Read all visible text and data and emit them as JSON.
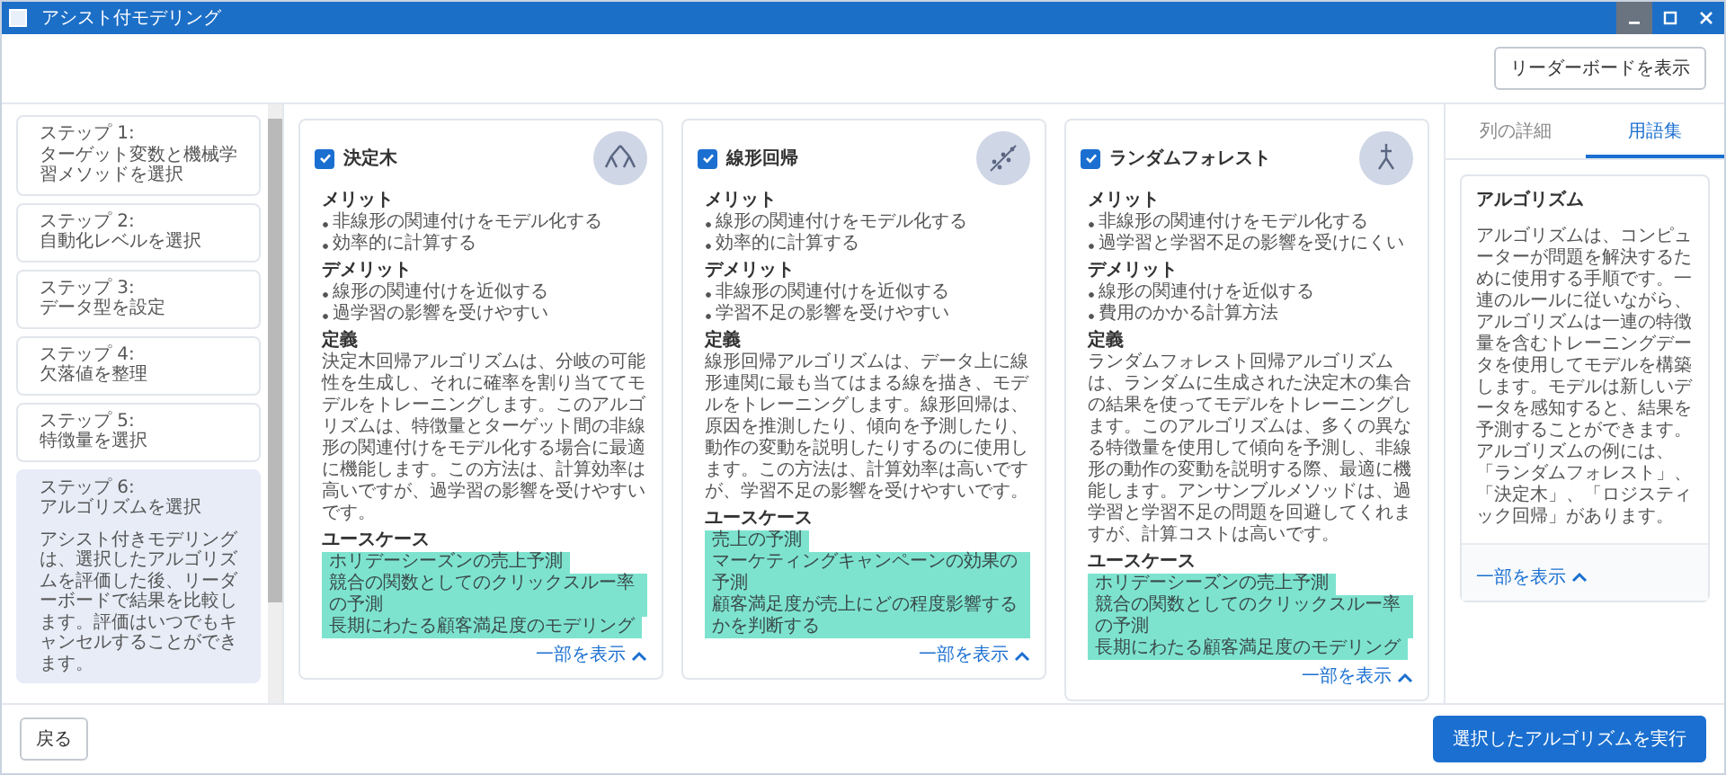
{
  "window": {
    "title": "アシスト付モデリング"
  },
  "toolbar": {
    "leaderboard_button": "リーダーボードを表示"
  },
  "steps": [
    {
      "label": "ステップ 1:",
      "title": "ターゲット変数と機械学習メソッドを選択",
      "selected": false
    },
    {
      "label": "ステップ 2:",
      "title": "自動化レベルを選択",
      "selected": false
    },
    {
      "label": "ステップ 3:",
      "title": "データ型を設定",
      "selected": false
    },
    {
      "label": "ステップ 4:",
      "title": "欠落値を整理",
      "selected": false
    },
    {
      "label": "ステップ 5:",
      "title": "特徴量を選択",
      "selected": false
    },
    {
      "label": "ステップ 6:",
      "title": "アルゴリズムを選択",
      "selected": true,
      "description": "アシスト付きモデリングは、選択したアルゴリズムを評価した後、リーダーボードで結果を比較します。評価はいつでもキャンセルすることができます。"
    }
  ],
  "algorithms": [
    {
      "name": "決定木",
      "checked": true,
      "kind": "tree",
      "merits_heading": "メリット",
      "merits": [
        "非線形の関連付けをモデル化する",
        "効率的に計算する"
      ],
      "demerits_heading": "デメリット",
      "demerits": [
        "線形の関連付けを近似する",
        "過学習の影響を受けやすい"
      ],
      "definition_heading": "定義",
      "definition": "決定木回帰アルゴリズムは、分岐の可能性を生成し、それに確率を割り当ててモデルをトレーニングします。このアルゴリズムは、特徴量とターゲット間の非線形の関連付けをモデル化する場合に最適に機能します。この方法は、計算効率は高いですが、過学習の影響を受けやすいです。",
      "usecases_heading": "ユースケース",
      "usecases": [
        "ホリデーシーズンの売上予測",
        "競合の関数としてのクリックスルー率の予測",
        "長期にわたる顧客満足度のモデリング"
      ],
      "show_less": "一部を表示"
    },
    {
      "name": "線形回帰",
      "checked": true,
      "kind": "scatter",
      "merits_heading": "メリット",
      "merits": [
        "線形の関連付けをモデル化する",
        "効率的に計算する"
      ],
      "demerits_heading": "デメリット",
      "demerits": [
        "非線形の関連付けを近似する",
        "学習不足の影響を受けやすい"
      ],
      "definition_heading": "定義",
      "definition": "線形回帰アルゴリズムは、データ上に線形連関に最も当てはまる線を描き、モデルをトレーニングします。線形回帰は、原因を推測したり、傾向を予測したり、動作の変動を説明したりするのに使用します。この方法は、計算効率は高いですが、学習不足の影響を受けやすいです。",
      "usecases_heading": "ユースケース",
      "usecases": [
        "売上の予測",
        "マーケティングキャンペーンの効果の予測",
        "顧客満足度が売上にどの程度影響するかを判断する"
      ],
      "show_less": "一部を表示"
    },
    {
      "name": "ランダムフォレスト",
      "checked": true,
      "kind": "forest",
      "merits_heading": "メリット",
      "merits": [
        "非線形の関連付けをモデル化する",
        "過学習と学習不足の影響を受けにくい"
      ],
      "demerits_heading": "デメリット",
      "demerits": [
        "線形の関連付けを近似する",
        "費用のかかる計算方法"
      ],
      "definition_heading": "定義",
      "definition": "ランダムフォレスト回帰アルゴリズムは、ランダムに生成された決定木の集合の結果を使ってモデルをトレーニングします。このアルゴリズムは、多くの異なる特徴量を使用して傾向を予測し、非線形の動作の変動を説明する際、最適に機能します。アンサンブルメソッドは、過学習と学習不足の問題を回避してくれますが、計算コストは高いです。",
      "usecases_heading": "ユースケース",
      "usecases": [
        "ホリデーシーズンの売上予測",
        "競合の関数としてのクリックスルー率の予測",
        "長期にわたる顧客満足度のモデリング"
      ],
      "show_less": "一部を表示"
    }
  ],
  "side_panel": {
    "tabs": [
      {
        "label": "列の詳細",
        "selected": false
      },
      {
        "label": "用語集",
        "selected": true
      }
    ],
    "glossary": {
      "term": "アルゴリズム",
      "text": "アルゴリズムは、コンピューターが問題を解決するために使用する手順です。一連のルールに従いながら、アルゴリズムは一連の特徴量を含むトレーニングデータを使用してモデルを構築します。モデルは新しいデータを感知すると、結果を予測することができます。アルゴリズムの例には、「ランダムフォレスト」、「決定木」、「ロジスティック回帰」があります。",
      "show_less": "一部を表示"
    }
  },
  "footer": {
    "back_button": "戻る",
    "run_button": "選択したアルゴリズムを実行"
  }
}
